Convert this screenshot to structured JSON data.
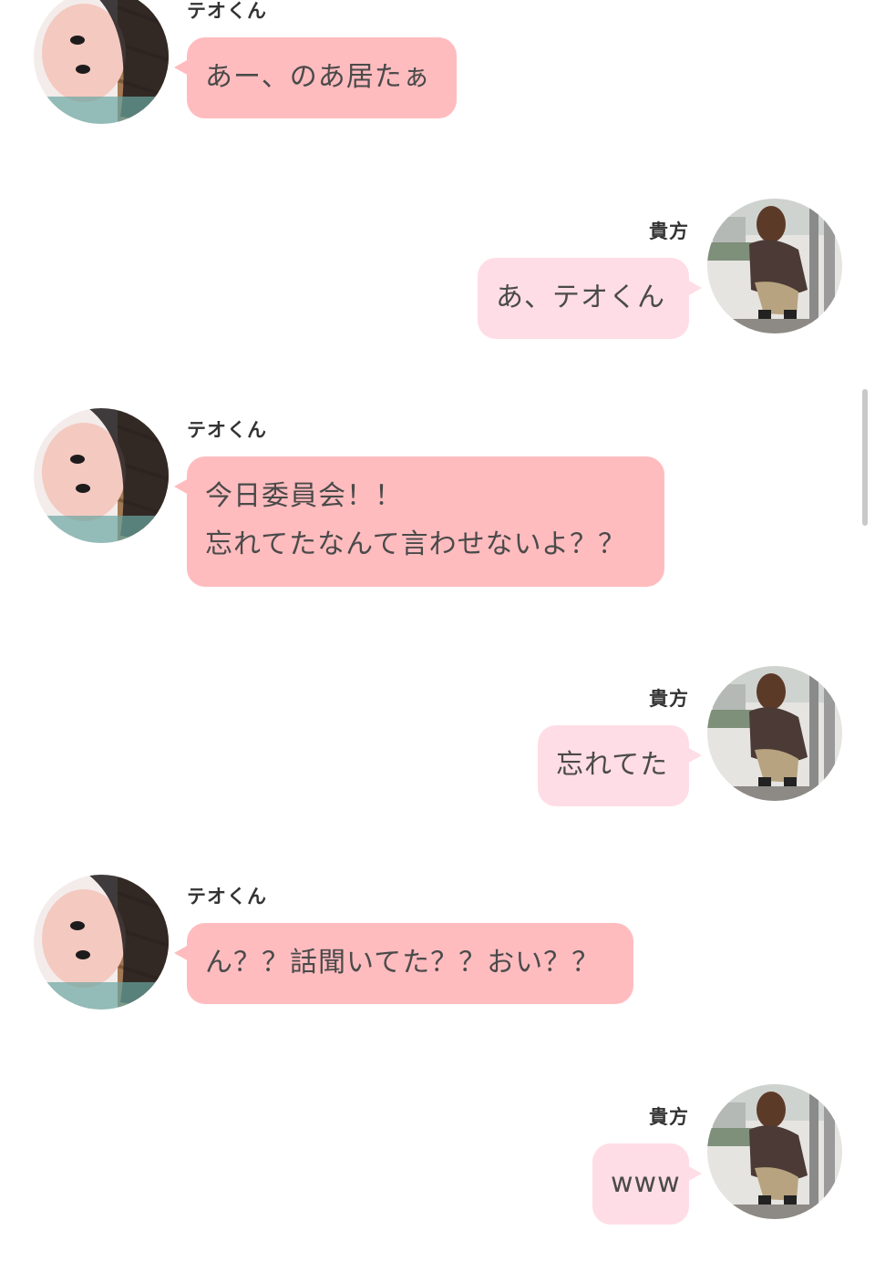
{
  "conversation": {
    "messages": [
      {
        "speaker": "テオくん",
        "text_lines": [
          "あー、のあ居たぁ"
        ],
        "side": "left"
      },
      {
        "speaker": "貴方",
        "text_lines": [
          "あ、テオくん"
        ],
        "side": "right"
      },
      {
        "speaker": "テオくん",
        "text_lines": [
          "今日委員会！！",
          "忘れてたなんて言わせないよ？？"
        ],
        "side": "left"
      },
      {
        "speaker": "貴方",
        "text_lines": [
          "忘れてた"
        ],
        "side": "right"
      },
      {
        "speaker": "テオくん",
        "text_lines": [
          "ん？？話聞いてた？？おい？？"
        ],
        "side": "left"
      },
      {
        "speaker": "貴方",
        "text_lines": [
          "www"
        ],
        "side": "right"
      }
    ]
  },
  "colors": {
    "teo_bubble": "#ffbcbf",
    "me_bubble": "#ffdde6",
    "text": "#4a4a4a",
    "name_text": "#333333"
  }
}
